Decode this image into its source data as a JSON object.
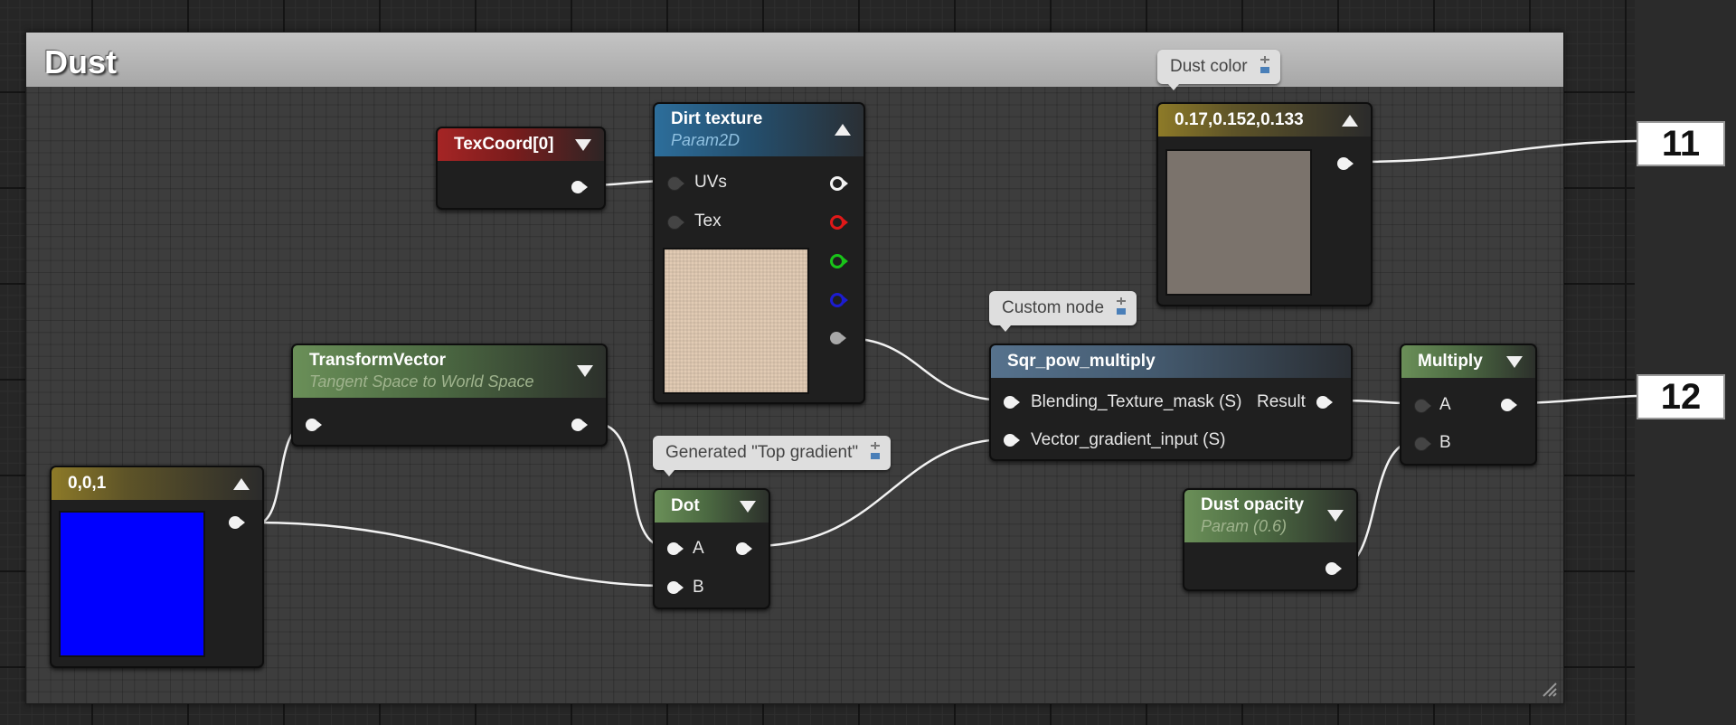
{
  "comment_box": {
    "title": "Dust"
  },
  "nodes": {
    "texcoord": {
      "title": "TexCoord[0]"
    },
    "dirt_texture": {
      "title": "Dirt texture",
      "subtitle": "Param2D",
      "inputs": [
        "UVs",
        "Tex"
      ],
      "swatch_color": "#e2cbb4"
    },
    "dust_color": {
      "title": "0.17,0.152,0.133",
      "swatch_color": "#7b736c",
      "comment": "Dust color"
    },
    "transform_vector": {
      "title": "TransformVector",
      "subtitle": "Tangent Space to World Space"
    },
    "vector_constant": {
      "title": "0,0,1",
      "swatch_color": "#0000ff"
    },
    "dot": {
      "title": "Dot",
      "inputs": [
        "A",
        "B"
      ],
      "comment": "Generated \"Top gradient\""
    },
    "sqr_pow_multiply": {
      "title": "Sqr_pow_multiply",
      "inputs": [
        "Blending_Texture_mask (S)",
        "Vector_gradient_input (S)"
      ],
      "output": "Result",
      "comment": "Custom node"
    },
    "multiply": {
      "title": "Multiply",
      "inputs": [
        "A",
        "B"
      ]
    },
    "dust_opacity": {
      "title": "Dust opacity",
      "subtitle": "Param (0.6)"
    }
  },
  "output_labels": [
    "11",
    "12"
  ],
  "colors": {
    "graph_background": "#262626",
    "comment_header": "#b5b5b5",
    "wire": "#f2f2f2",
    "pin_red": "#e01818",
    "pin_green": "#19c419",
    "pin_blue": "#1c1cd0"
  }
}
